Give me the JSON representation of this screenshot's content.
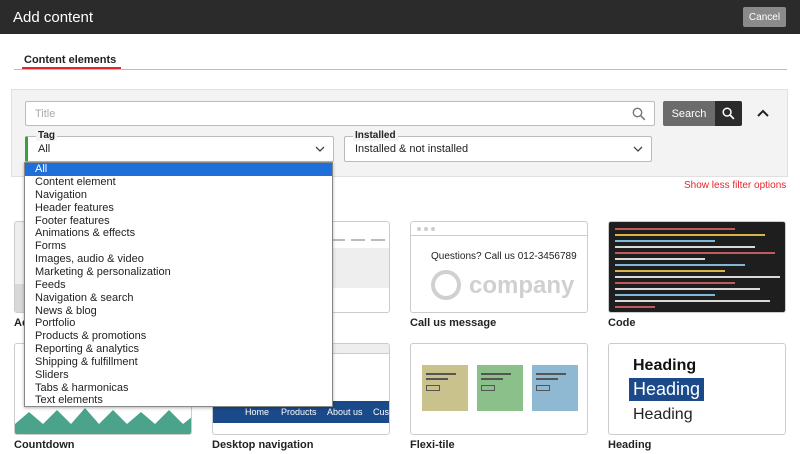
{
  "dialog": {
    "title": "Add content",
    "cancel_label": "Cancel"
  },
  "tabs": [
    {
      "label": "Content elements",
      "active": true
    }
  ],
  "search": {
    "placeholder": "Title",
    "value": "",
    "button_label": "Search"
  },
  "filters": {
    "tag": {
      "label": "Tag",
      "value": "All"
    },
    "installed": {
      "label": "Installed",
      "value": "Installed & not installed"
    },
    "toggle_label": "Show less filter options"
  },
  "tag_options": [
    "All",
    "Content element",
    "Navigation",
    "Header features",
    "Footer features",
    "Animations & effects",
    "Forms",
    "Images, audio & video",
    "Marketing & personalization",
    "Feeds",
    "Navigation & search",
    "News & blog",
    "Portfolio",
    "Products & promotions",
    "Reporting & analytics",
    "Shipping & fulfillment",
    "Sliders",
    "Tabs & harmonicas",
    "Text elements"
  ],
  "selected_tag_index": 0,
  "cards": [
    {
      "label": "Ac"
    },
    {
      "label": ""
    },
    {
      "label": "Call us message",
      "preview_text": "Questions? Call us 012-3456789",
      "preview_logo": "company"
    },
    {
      "label": "Code"
    },
    {
      "label": "Countdown"
    },
    {
      "label": "Desktop navigation",
      "nav_items": [
        "Home",
        "Products",
        "About us",
        "Cust"
      ]
    },
    {
      "label": "Flexi-tile"
    },
    {
      "label": "Heading",
      "preview_headings": [
        "Heading",
        "Heading",
        "Heading"
      ]
    }
  ],
  "colors": {
    "accent_red": "#e3262e",
    "topbar": "#2b2b2b",
    "selection_blue": "#1e6fd9",
    "nav_blue": "#1a4a8a",
    "tile_colors": [
      "#c9c28d",
      "#8cc08a",
      "#8fb9d2"
    ],
    "countdown_green": "#4aa38a"
  },
  "icons": {
    "search": "magnifier-icon",
    "collapse": "chevron-up-icon",
    "select": "chevron-down-icon"
  }
}
